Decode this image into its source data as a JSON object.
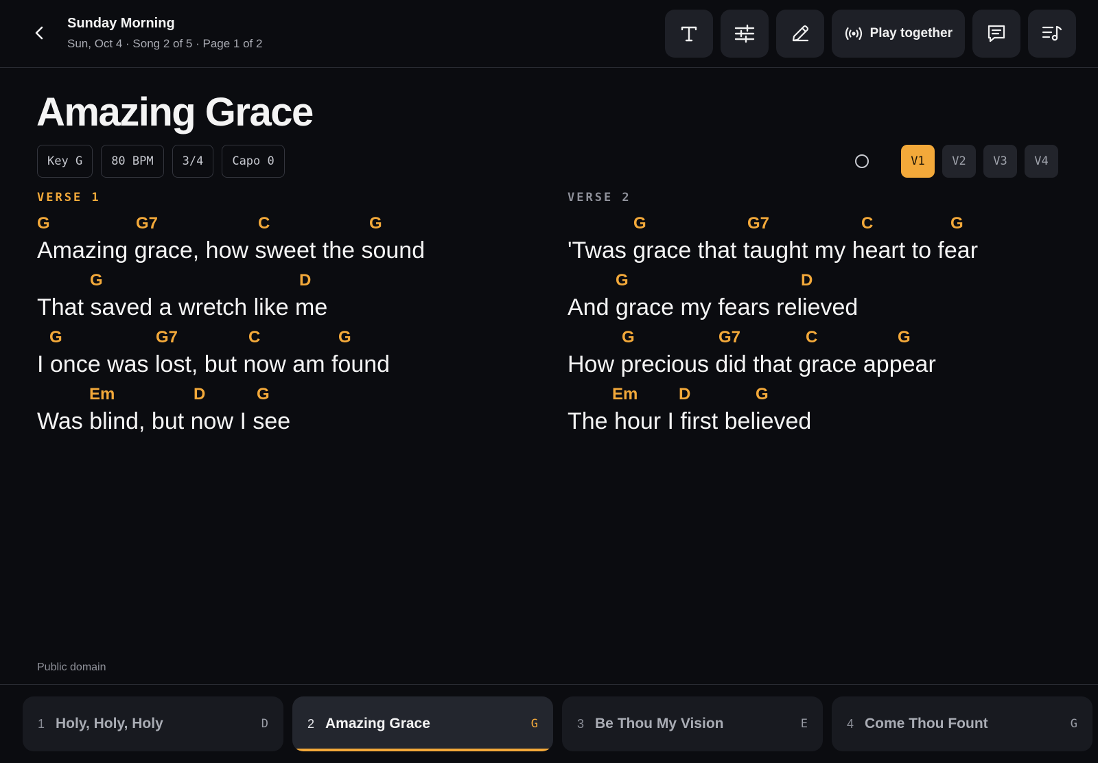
{
  "header": {
    "set_title": "Sunday Morning",
    "set_meta": "Sun, Oct 4 · Song 2 of 5 · Page 1 of 2",
    "play_together_label": "Play together"
  },
  "song": {
    "title": "Amazing Grace",
    "meta_chips": [
      "Key G",
      "80 BPM",
      "3/4",
      "Capo 0"
    ],
    "verse_buttons": [
      "V1",
      "V2",
      "V3",
      "V4"
    ],
    "active_verse": "V1"
  },
  "verses": [
    {
      "label": "VERSE 1",
      "label_color": "#f3a93a",
      "lines": [
        {
          "lyric": "Amazing grace, how sweet the sound",
          "chords": [
            "G",
            "G7",
            "C",
            "G"
          ]
        },
        {
          "lyric": "That saved a wretch like me",
          "chords": [
            "G",
            "D"
          ]
        },
        {
          "lyric": "I once was lost, but now am found",
          "chords": [
            "G",
            "G7",
            "C",
            "G"
          ]
        },
        {
          "lyric": "Was blind, but now I see",
          "chords": [
            "Em",
            "D",
            "G"
          ]
        }
      ]
    },
    {
      "label": "VERSE 2",
      "label_color": "#8e9099",
      "lines": [
        {
          "lyric": "'Twas grace that taught my heart to fear",
          "chords": [
            "G",
            "G7",
            "C",
            "G"
          ]
        },
        {
          "lyric": "And grace my fears relieved",
          "chords": [
            "G",
            "D"
          ]
        },
        {
          "lyric": "How precious did that grace appear",
          "chords": [
            "G",
            "G7",
            "C",
            "G"
          ]
        },
        {
          "lyric": "The hour I first believed",
          "chords": [
            "Em",
            "D",
            "G"
          ]
        }
      ]
    }
  ],
  "license": "Public domain",
  "setlist": [
    {
      "num": "1",
      "title": "Holy, Holy, Holy",
      "key": "D",
      "active": false
    },
    {
      "num": "2",
      "title": "Amazing Grace",
      "key": "G",
      "active": true
    },
    {
      "num": "3",
      "title": "Be Thou My Vision",
      "key": "E",
      "active": false
    },
    {
      "num": "4",
      "title": "Come Thou Fount",
      "key": "G",
      "active": false
    }
  ],
  "colors": {
    "accent": "#f3a93a",
    "background": "#0b0c10",
    "button_bg": "#1e2027"
  },
  "icons": [
    "back-chevron-icon",
    "text-size-icon",
    "sliders-icon",
    "pencil-icon",
    "broadcast-icon",
    "comment-icon",
    "setlist-icon",
    "autoscroll-circle-icon"
  ]
}
